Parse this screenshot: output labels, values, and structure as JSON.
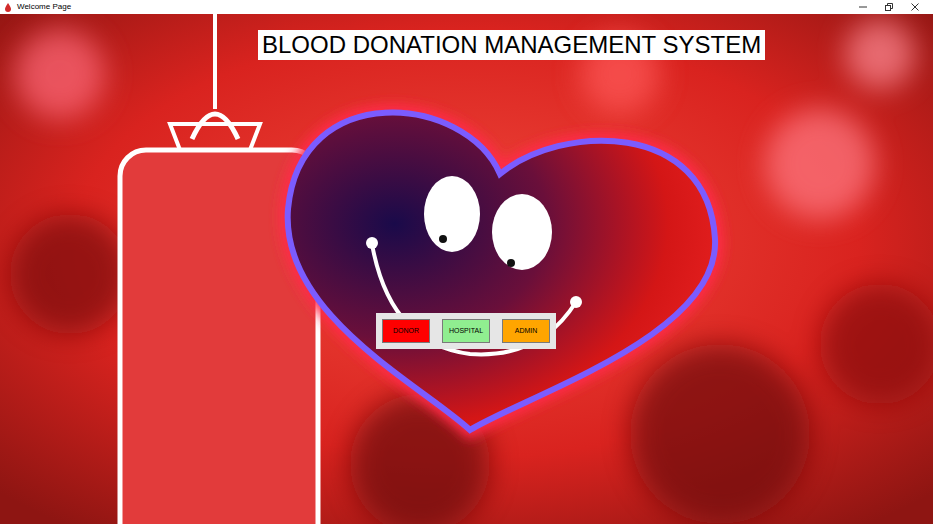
{
  "window": {
    "title": "Welcome Page"
  },
  "heading": "BLOOD DONATION MANAGEMENT SYSTEM",
  "buttons": [
    {
      "label": "DONOR",
      "color": "#ff0000"
    },
    {
      "label": "HOSPITAL",
      "color": "#90ee90"
    },
    {
      "label": "ADMIN",
      "color": "#ffa500"
    }
  ]
}
